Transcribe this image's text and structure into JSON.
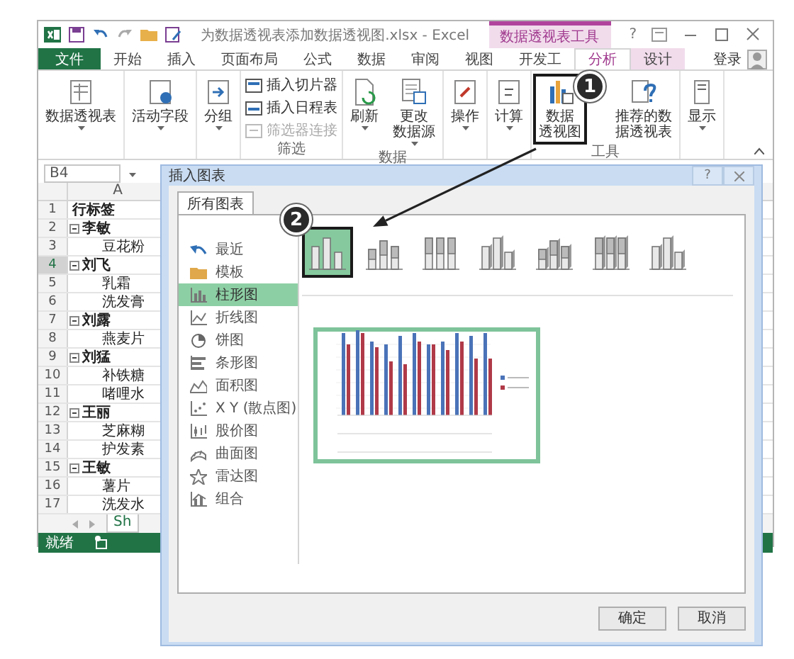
{
  "window": {
    "title": "为数据透视表添加数据透视图.xlsx - Excel",
    "context_tab": "数据透视表工具",
    "help": "?"
  },
  "ribbon_tabs": [
    {
      "label": "文件",
      "kind": "file",
      "selected": false
    },
    {
      "label": "开始",
      "kind": "normal",
      "selected": false
    },
    {
      "label": "插入",
      "kind": "normal",
      "selected": false
    },
    {
      "label": "页面布局",
      "kind": "normal",
      "selected": false
    },
    {
      "label": "公式",
      "kind": "normal",
      "selected": false
    },
    {
      "label": "数据",
      "kind": "normal",
      "selected": false
    },
    {
      "label": "审阅",
      "kind": "normal",
      "selected": false
    },
    {
      "label": "视图",
      "kind": "normal",
      "selected": false
    },
    {
      "label": "开发工",
      "kind": "normal",
      "selected": false
    },
    {
      "label": "分析",
      "kind": "context",
      "selected": true
    },
    {
      "label": "设计",
      "kind": "context",
      "selected": false
    }
  ],
  "account": "登录",
  "ribbon_groups": [
    {
      "buttons": [
        {
          "kind": "large",
          "lines": [
            "数据透视表"
          ],
          "dropdown": true,
          "marked": false
        }
      ]
    },
    {
      "buttons": [
        {
          "kind": "large",
          "lines": [
            "活动字段"
          ],
          "dropdown": true,
          "marked": false
        }
      ]
    },
    {
      "buttons": [
        {
          "kind": "large",
          "lines": [
            "分组"
          ],
          "dropdown": true,
          "marked": false
        }
      ]
    },
    {
      "label": "筛选",
      "buttons": [
        {
          "kind": "small",
          "label": "插入切片器",
          "disabled": false
        },
        {
          "kind": "small",
          "label": "插入日程表",
          "disabled": false
        },
        {
          "kind": "small",
          "label": "筛选器连接",
          "disabled": true
        }
      ]
    },
    {
      "label": "数据",
      "buttons": [
        {
          "kind": "large",
          "lines": [
            "刷新"
          ],
          "dropdown": true,
          "marked": false
        },
        {
          "kind": "large",
          "lines": [
            "更改",
            "数据源"
          ],
          "dropdown": true,
          "marked": false
        }
      ]
    },
    {
      "buttons": [
        {
          "kind": "large",
          "lines": [
            "操作"
          ],
          "dropdown": true,
          "marked": false
        }
      ]
    },
    {
      "buttons": [
        {
          "kind": "large",
          "lines": [
            "计算"
          ],
          "dropdown": true,
          "marked": false
        }
      ]
    },
    {
      "label": "工具",
      "buttons": [
        {
          "kind": "large",
          "lines": [
            "数据",
            "透视图"
          ],
          "dropdown": false,
          "marked": true
        },
        {
          "kind": "large",
          "lines": [
            "推荐的数",
            "据透视表"
          ],
          "dropdown": false,
          "marked": false
        }
      ]
    },
    {
      "buttons": [
        {
          "kind": "large",
          "lines": [
            "显示"
          ],
          "dropdown": true,
          "marked": false
        }
      ]
    }
  ],
  "name_box": "B4",
  "columns": [
    "A"
  ],
  "rows": [
    {
      "row": "1",
      "label": "行标签",
      "kind": "header",
      "selected": false
    },
    {
      "row": "2",
      "label": "李敏",
      "kind": "group",
      "expanded": true,
      "selected": false,
      "children": [
        {
          "row": "3",
          "label": "豆花粉",
          "kind": "item",
          "selected": false
        }
      ]
    },
    {
      "row": "4",
      "label": "刘飞",
      "kind": "group",
      "expanded": true,
      "selected": true,
      "children": [
        {
          "row": "5",
          "label": "乳霜",
          "kind": "item",
          "selected": false
        },
        {
          "row": "6",
          "label": "洗发膏",
          "kind": "item",
          "selected": false
        }
      ]
    },
    {
      "row": "7",
      "label": "刘露",
      "kind": "group",
      "expanded": true,
      "selected": false,
      "children": [
        {
          "row": "8",
          "label": "燕麦片",
          "kind": "item",
          "selected": false
        }
      ]
    },
    {
      "row": "9",
      "label": "刘猛",
      "kind": "group",
      "expanded": true,
      "selected": false,
      "children": [
        {
          "row": "10",
          "label": "补铁糖",
          "kind": "item",
          "selected": false
        },
        {
          "row": "11",
          "label": "啫哩水",
          "kind": "item",
          "selected": false
        }
      ]
    },
    {
      "row": "12",
      "label": "王丽",
      "kind": "group",
      "expanded": true,
      "selected": false,
      "children": [
        {
          "row": "13",
          "label": "芝麻糊",
          "kind": "item",
          "selected": false
        },
        {
          "row": "14",
          "label": "护发素",
          "kind": "item",
          "selected": false
        }
      ]
    },
    {
      "row": "15",
      "label": "王敏",
      "kind": "group",
      "expanded": true,
      "selected": false,
      "children": [
        {
          "row": "16",
          "label": "薯片",
          "kind": "item",
          "selected": false
        },
        {
          "row": "17",
          "label": "洗发水",
          "kind": "item",
          "selected": false
        }
      ]
    }
  ],
  "sheet_tabs": [
    {
      "label": "Sh"
    }
  ],
  "status_bar": {
    "text": "就绪"
  },
  "dialog": {
    "title": "插入图表",
    "help": "?",
    "tabs": [
      {
        "label": "所有图表",
        "selected": true
      }
    ],
    "chart_types": [
      {
        "label": "最近",
        "selected": false
      },
      {
        "label": "模板",
        "selected": false
      },
      {
        "label": "柱形图",
        "selected": true
      },
      {
        "label": "折线图",
        "selected": false
      },
      {
        "label": "饼图",
        "selected": false
      },
      {
        "label": "条形图",
        "selected": false
      },
      {
        "label": "面积图",
        "selected": false
      },
      {
        "label": "X Y (散点图)",
        "selected": false
      },
      {
        "label": "股价图",
        "selected": false
      },
      {
        "label": "曲面图",
        "selected": false
      },
      {
        "label": "雷达图",
        "selected": false
      },
      {
        "label": "组合",
        "selected": false
      }
    ],
    "subtypes": [
      {
        "selected": true,
        "marked": true
      },
      {
        "selected": false,
        "marked": false
      },
      {
        "selected": false,
        "marked": false
      },
      {
        "selected": false,
        "marked": false
      },
      {
        "selected": false,
        "marked": false
      },
      {
        "selected": false,
        "marked": false
      },
      {
        "selected": false,
        "marked": false
      }
    ],
    "buttons": [
      "确定",
      "取消"
    ]
  },
  "callouts": [
    {
      "label": "1"
    },
    {
      "label": "2"
    }
  ]
}
